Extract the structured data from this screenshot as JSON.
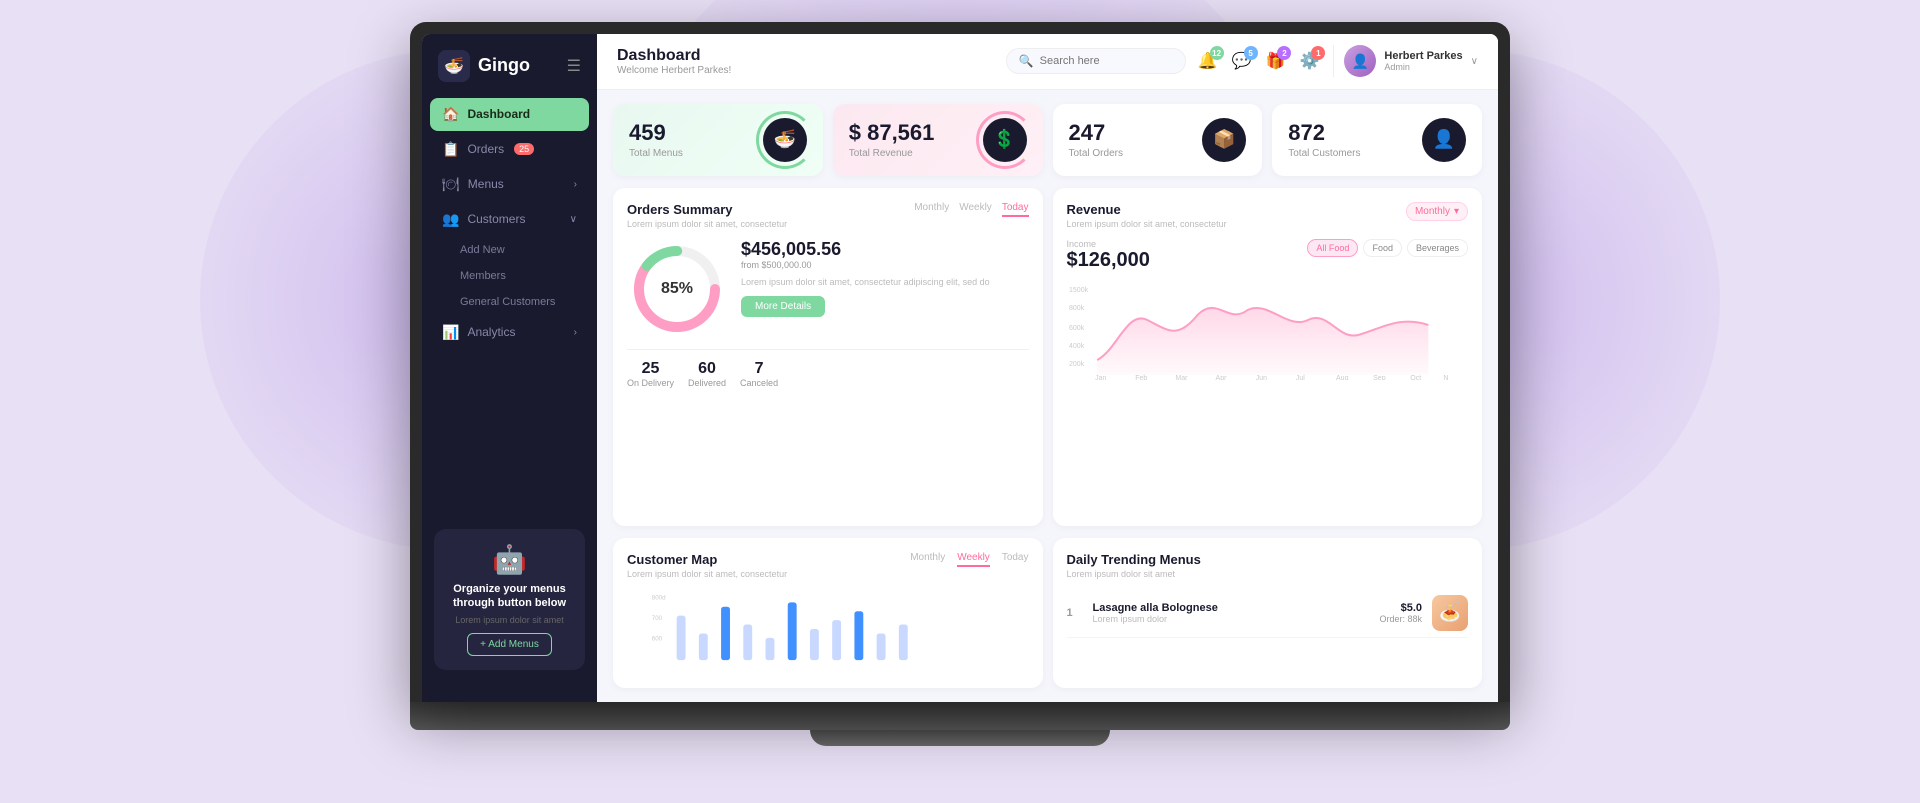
{
  "app": {
    "name": "Gingo"
  },
  "header": {
    "title": "Dashboard",
    "subtitle": "Welcome Herbert Parkes!",
    "search_placeholder": "Search here",
    "user": {
      "name": "Herbert Parkes",
      "role": "Admin"
    },
    "notifications": {
      "bell_count": "12",
      "chat_count": "5",
      "gift_count": "2",
      "settings_count": "1"
    }
  },
  "sidebar": {
    "nav_items": [
      {
        "id": "dashboard",
        "label": "Dashboard",
        "icon": "🏠",
        "active": true
      },
      {
        "id": "orders",
        "label": "Orders",
        "icon": "📋",
        "badge": "25"
      },
      {
        "id": "menus",
        "label": "Menus",
        "icon": "🍽",
        "arrow": true
      },
      {
        "id": "customers",
        "label": "Customers",
        "icon": "👥",
        "arrow": true
      },
      {
        "id": "analytics",
        "label": "Analytics",
        "icon": "📊",
        "arrow": true
      }
    ],
    "sub_items": [
      "Add New",
      "Members",
      "General Customers"
    ],
    "promo": {
      "title": "Organize your menus through button below",
      "subtitle": "Lorem ipsum dolor sit amet",
      "button": "+ Add Menus"
    }
  },
  "stats": [
    {
      "value": "459",
      "label": "Total Menus",
      "icon": "🍜",
      "variant": "green"
    },
    {
      "value": "$ 87,561",
      "label": "Total Revenue",
      "icon": "💲",
      "variant": "pink"
    },
    {
      "value": "247",
      "label": "Total Orders",
      "icon": "📦",
      "variant": "white"
    },
    {
      "value": "872",
      "label": "Total Customers",
      "icon": "👤",
      "variant": "white"
    }
  ],
  "orders_summary": {
    "title": "Orders Summary",
    "subtitle": "Lorem ipsum dolor sit amet, consectetur",
    "percentage": "85%",
    "amount": "$456,005.56",
    "from_text": "from $500,000.00",
    "description": "Lorem ipsum dolor sit amet, consectetur adipiscing elit, sed do",
    "more_button": "More Details",
    "delivery": [
      {
        "num": "25",
        "label": "On Delivery"
      },
      {
        "num": "60",
        "label": "Delivered"
      },
      {
        "num": "7",
        "label": "Canceled"
      }
    ],
    "tabs": [
      {
        "label": "Monthly",
        "active": false
      },
      {
        "label": "Weekly",
        "active": false
      },
      {
        "label": "Today",
        "active": true
      }
    ]
  },
  "revenue": {
    "title": "Revenue",
    "subtitle": "Lorem ipsum dolor sit amet, consectetur",
    "amount": "$126,000",
    "amount_label": "Income",
    "dropdown": "Monthly",
    "filters": [
      {
        "label": "All Food",
        "active": true
      },
      {
        "label": "Food",
        "active": false
      },
      {
        "label": "Beverages",
        "active": false
      }
    ],
    "chart_labels": [
      "Jan",
      "Feb",
      "Mar",
      "Apr",
      "Jun",
      "Jul",
      "Aug",
      "Sep",
      "Oct",
      "N"
    ],
    "chart_y_labels": [
      "1500k",
      "800k",
      "600k",
      "400k",
      "200k"
    ]
  },
  "customer_map": {
    "title": "Customer Map",
    "subtitle": "Lorem ipsum dolor sit amet, consectetur",
    "tabs": [
      {
        "label": "Monthly",
        "active": false
      },
      {
        "label": "Weekly",
        "active": true
      },
      {
        "label": "Today",
        "active": false
      }
    ],
    "y_labels": [
      "800d",
      "700",
      "600"
    ]
  },
  "trending_menus": {
    "title": "Daily Trending Menus",
    "subtitle": "Lorem ipsum dolor sit amet",
    "items": [
      {
        "rank": "1",
        "name": "Lasagne alla Bolognese",
        "sub": "Lorem ipsum dolor",
        "price": "$5.0",
        "orders": "Order: 88k",
        "emoji": "🍝"
      }
    ]
  }
}
